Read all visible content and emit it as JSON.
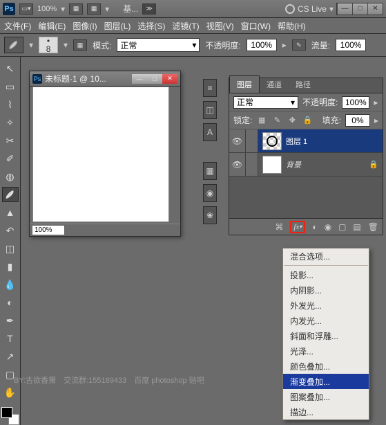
{
  "titlebar": {
    "zoom": "100%",
    "base": "基...",
    "cslive": "CS Live"
  },
  "menu": [
    "文件(F)",
    "编辑(E)",
    "图像(I)",
    "图层(L)",
    "选择(S)",
    "滤镜(T)",
    "视图(V)",
    "窗口(W)",
    "帮助(H)"
  ],
  "options": {
    "brush_size": "8",
    "mode_label": "模式:",
    "mode_value": "正常",
    "opacity_label": "不透明度:",
    "opacity_value": "100%",
    "flow_label": "流量:",
    "flow_value": "100%"
  },
  "doc": {
    "title": "未标题-1 @ 10...",
    "zoom": "100%"
  },
  "panel": {
    "tabs": [
      "图层",
      "通道",
      "路径"
    ],
    "blend_label": "正常",
    "opacity_label": "不透明度:",
    "opacity_value": "100%",
    "lock_label": "锁定:",
    "fill_label": "填充:",
    "fill_value": "0%",
    "layers": [
      {
        "name": "图层 1"
      },
      {
        "name": "背景"
      }
    ]
  },
  "ctx": {
    "header": "混合选项...",
    "items": [
      "投影...",
      "内阴影...",
      "外发光...",
      "内发光...",
      "斜面和浮雕...",
      "光泽...",
      "颜色叠加...",
      "渐变叠加...",
      "图案叠加...",
      "描边..."
    ],
    "highlight": "渐变叠加..."
  },
  "watermark": "BY:古欲香箫　交流群:155189433　百度 photoshop 贴吧"
}
